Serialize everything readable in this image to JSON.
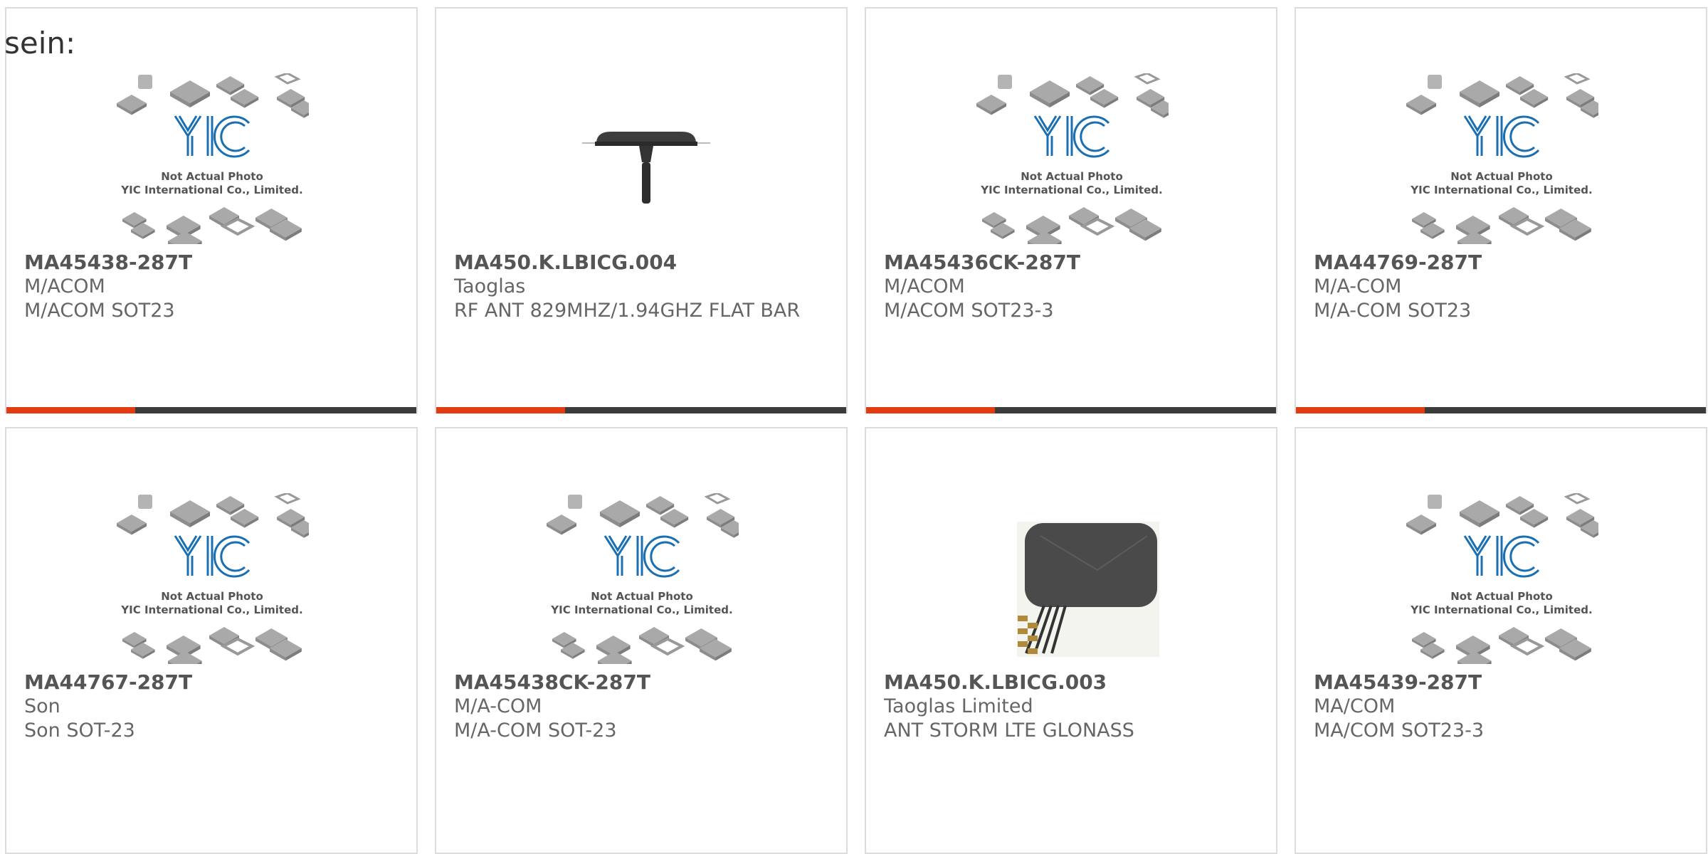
{
  "lead_text": "sein:",
  "placeholder": {
    "line1": "Not Actual Photo",
    "line2": "YIC International Co., Limited.",
    "logo": "YIC"
  },
  "colors": {
    "accent": "#e23b12",
    "bar": "#3b3b3b",
    "logo": "#1a6fb3"
  },
  "products": [
    {
      "part": "MA45438-287T",
      "maker": "M/ACOM",
      "desc": "M/ACOM SOT23",
      "image": "yic-placeholder"
    },
    {
      "part": "MA450.K.LBICG.004",
      "maker": "Taoglas",
      "desc": "RF ANT 829MHZ/1.94GHZ FLAT BAR",
      "image": "antenna-bar"
    },
    {
      "part": "MA45436CK-287T",
      "maker": "M/ACOM",
      "desc": "M/ACOM SOT23-3",
      "image": "yic-placeholder"
    },
    {
      "part": "MA44769-287T",
      "maker": "M/A-COM",
      "desc": "M/A-COM SOT23",
      "image": "yic-placeholder"
    },
    {
      "part": "MA44767-287T",
      "maker": "Son",
      "desc": "Son SOT-23",
      "image": "yic-placeholder"
    },
    {
      "part": "MA45438CK-287T",
      "maker": "M/A-COM",
      "desc": "M/A-COM SOT-23",
      "image": "yic-placeholder"
    },
    {
      "part": "MA450.K.LBICG.003",
      "maker": "Taoglas Limited",
      "desc": "ANT STORM LTE GLONASS",
      "image": "antenna-storm"
    },
    {
      "part": "MA45439-287T",
      "maker": "MA/COM",
      "desc": "MA/COM SOT23-3",
      "image": "yic-placeholder"
    }
  ]
}
